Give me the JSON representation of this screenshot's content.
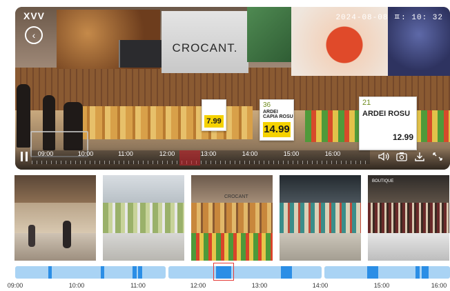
{
  "app": {
    "logo": "XVV"
  },
  "player": {
    "timestamp": "2024-08-08 ㅍ: 10: 32",
    "store_banner": "CROCANT.",
    "timeline_hours": [
      "09:00",
      "10:00",
      "11:00",
      "12:00",
      "13:00",
      "14:00",
      "15:00",
      "16:00"
    ],
    "icons": {
      "back": "back-arrow-icon",
      "pause": "pause-icon",
      "volume": "speaker-icon",
      "snapshot": "camera-icon",
      "download": "download-icon",
      "fullscreen": "expand-icon"
    }
  },
  "price_tags": [
    {
      "num": "36",
      "name": "ARDEI CAPIA ROSU",
      "price": "14.99"
    },
    {
      "num": "21",
      "name": "ARDEI ROSU",
      "price": "12.99"
    },
    {
      "num": "",
      "name": "",
      "price": "7.99"
    }
  ],
  "thumbnails": [
    {
      "label": "",
      "theme": "store-entrance"
    },
    {
      "label": "",
      "theme": "produce-aisle"
    },
    {
      "label": "CROCANT",
      "theme": "bakery"
    },
    {
      "label": "",
      "theme": "checkout-lanes"
    },
    {
      "label": "BOUTIQUE",
      "theme": "wine-counter"
    }
  ],
  "bottom_timeline": {
    "labels": [
      "09:00",
      "10:00",
      "11:00",
      "12:00",
      "13:00",
      "14:00",
      "15:00",
      "16:00"
    ],
    "selected_hour": "12:30"
  },
  "colors": {
    "accent_blue": "#2b8ee6",
    "segment_light": "#a9d3f4",
    "selection_red": "#e53935",
    "price_yellow": "#f5d200"
  }
}
